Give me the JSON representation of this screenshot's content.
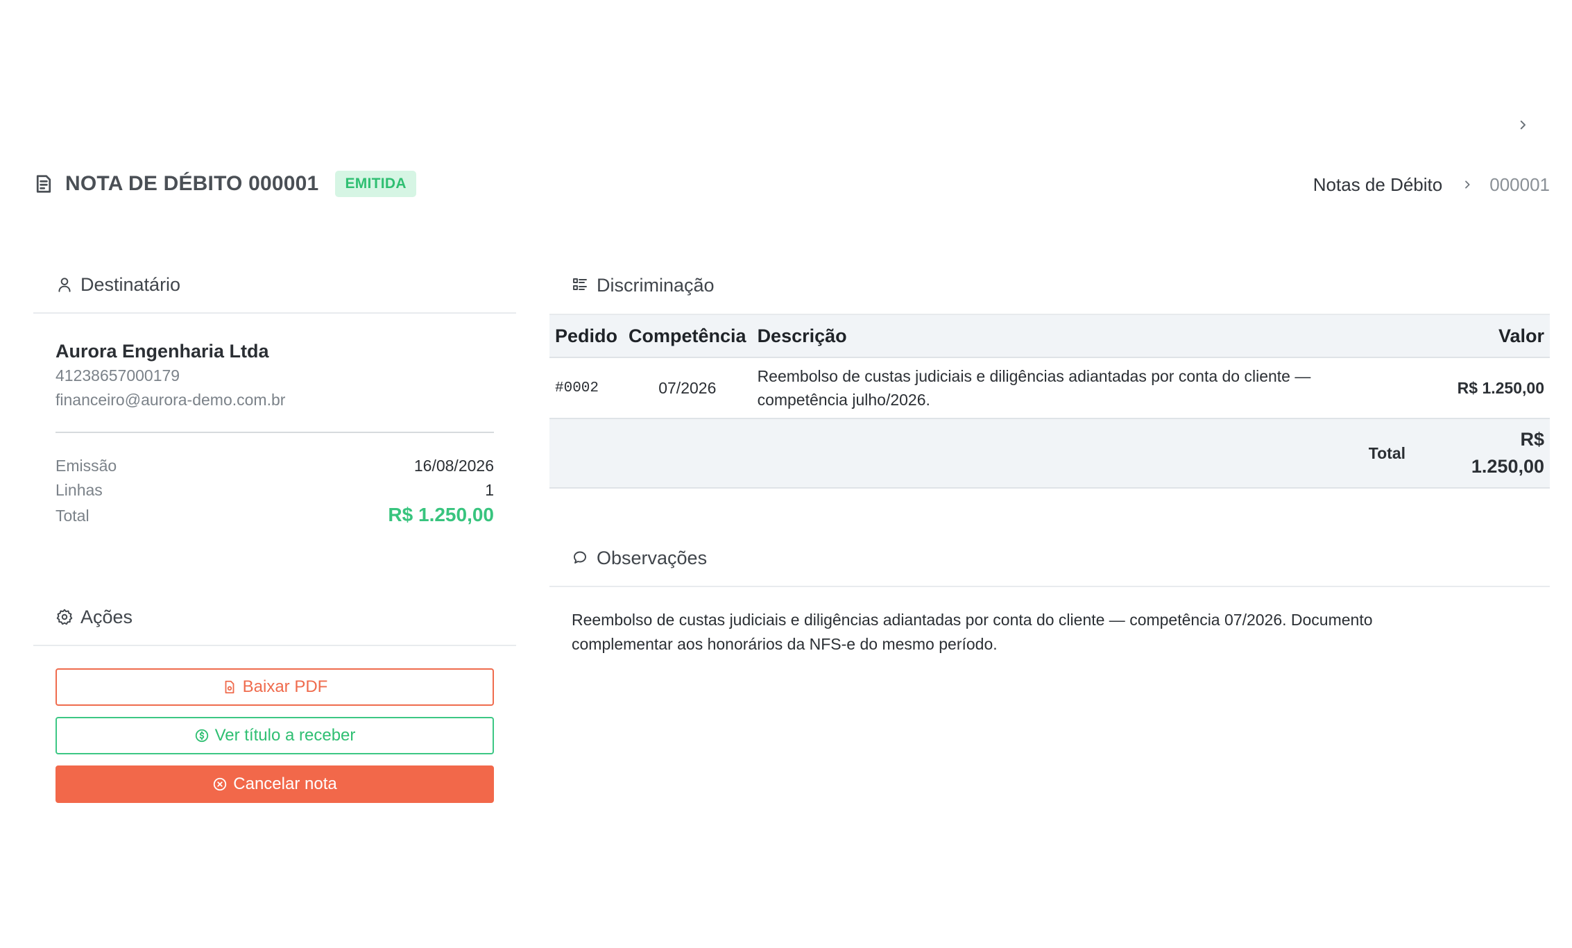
{
  "header": {
    "title": "NOTA DE DÉBITO 000001",
    "status": "EMITIDA"
  },
  "breadcrumb": {
    "parent": "Notas de Débito",
    "current": "000001"
  },
  "recipient": {
    "section_title": "Destinatário",
    "name": "Aurora Engenharia Ltda",
    "document": "41238657000179",
    "email": "financeiro@aurora-demo.com.br",
    "rows": [
      {
        "label": "Emissão",
        "value": "16/08/2026"
      },
      {
        "label": "Linhas",
        "value": "1"
      },
      {
        "label": "Total",
        "value": "R$ 1.250,00"
      }
    ]
  },
  "actions": {
    "section_title": "Ações",
    "download_pdf": "Baixar PDF",
    "view_receivable": "Ver título a receber",
    "cancel_note": "Cancelar nota"
  },
  "items": {
    "section_title": "Discriminação",
    "columns": {
      "order": "Pedido",
      "competence": "Competência",
      "description": "Descrição",
      "value": "Valor"
    },
    "rows": [
      {
        "order": "#0002",
        "competence": "07/2026",
        "description": "Reembolso de custas judiciais e diligências adiantadas por conta do cliente — competência julho/2026.",
        "value": "R$ 1.250,00"
      }
    ],
    "total_label": "Total",
    "total_currency": "R$",
    "total_amount": "1.250,00"
  },
  "observations": {
    "section_title": "Observações",
    "text": "Reembolso de custas judiciais e diligências adiantadas por conta do cliente — competência 07/2026. Documento complementar aos honorários da NFS-e do mesmo período."
  },
  "colors": {
    "success": "#38c47e",
    "danger": "#f2684a",
    "link_pink": "#e64aa0"
  }
}
